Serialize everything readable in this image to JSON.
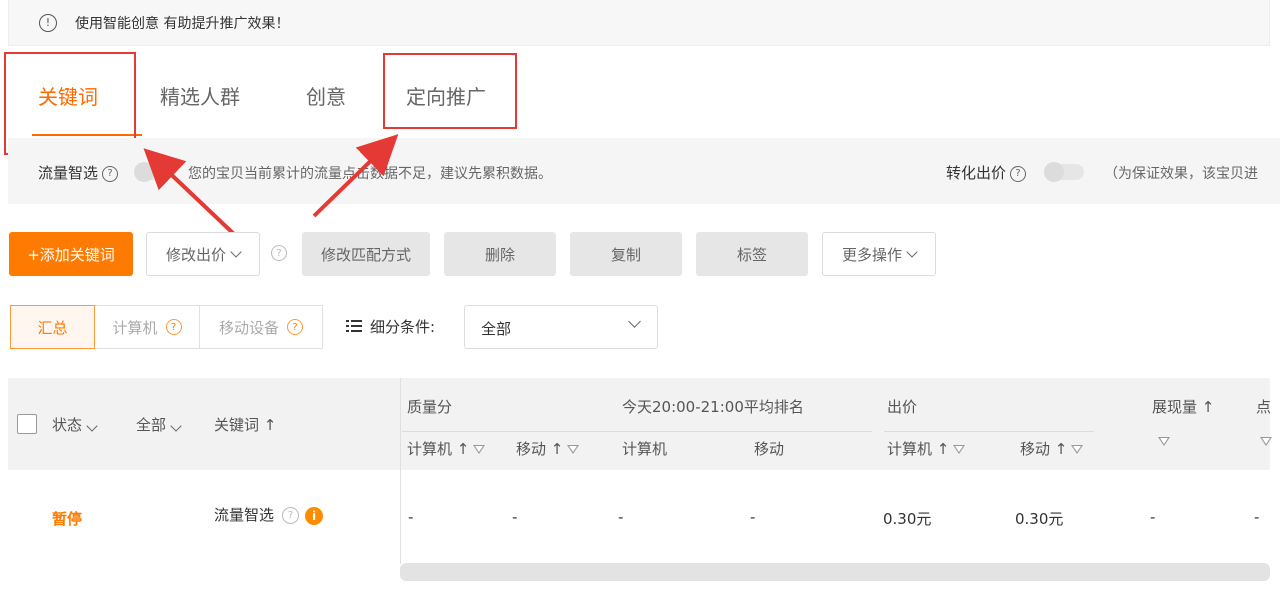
{
  "notice": {
    "icon": "info-icon",
    "text": "使用智能创意 有助提升推广效果！"
  },
  "tabs": [
    {
      "label": "关键词",
      "active": true
    },
    {
      "label": "精选人群",
      "active": false
    },
    {
      "label": "创意",
      "active": false
    },
    {
      "label": "定向推广",
      "active": false
    }
  ],
  "flow": {
    "label": "流量智选",
    "message": "您的宝贝当前累计的流量点击数据不足，建议先累积数据。",
    "conversion_label": "转化出价",
    "conversion_note": "（为保证效果，该宝贝进"
  },
  "toolbar": {
    "add": "+添加关键词",
    "modify_bid": "修改出价",
    "modify_match": "修改匹配方式",
    "delete": "删除",
    "copy": "复制",
    "tag": "标签",
    "more": "更多操作"
  },
  "filters": {
    "segments": [
      "汇总",
      "计算机",
      "移动设备"
    ],
    "condition_label": "细分条件:",
    "condition_value": "全部"
  },
  "table": {
    "status": "状态",
    "all": "全部",
    "keyword": "关键词 ↑",
    "quality": "质量分",
    "rank": "今天20:00-21:00平均排名",
    "bid": "出价",
    "impressions": "展现量 ↑",
    "more_col": "点",
    "pc_sort": "计算机 ↑",
    "mobile_sort": "移动 ↑",
    "pc": "计算机",
    "mobile": "移动"
  },
  "row": {
    "status": "暂停",
    "keyword": "流量智选",
    "info": "i",
    "dash": "-",
    "bid_pc": "0.30元",
    "bid_mobile": "0.30元"
  },
  "colors": {
    "accent": "#ff7a00",
    "annotation": "#e53935"
  }
}
